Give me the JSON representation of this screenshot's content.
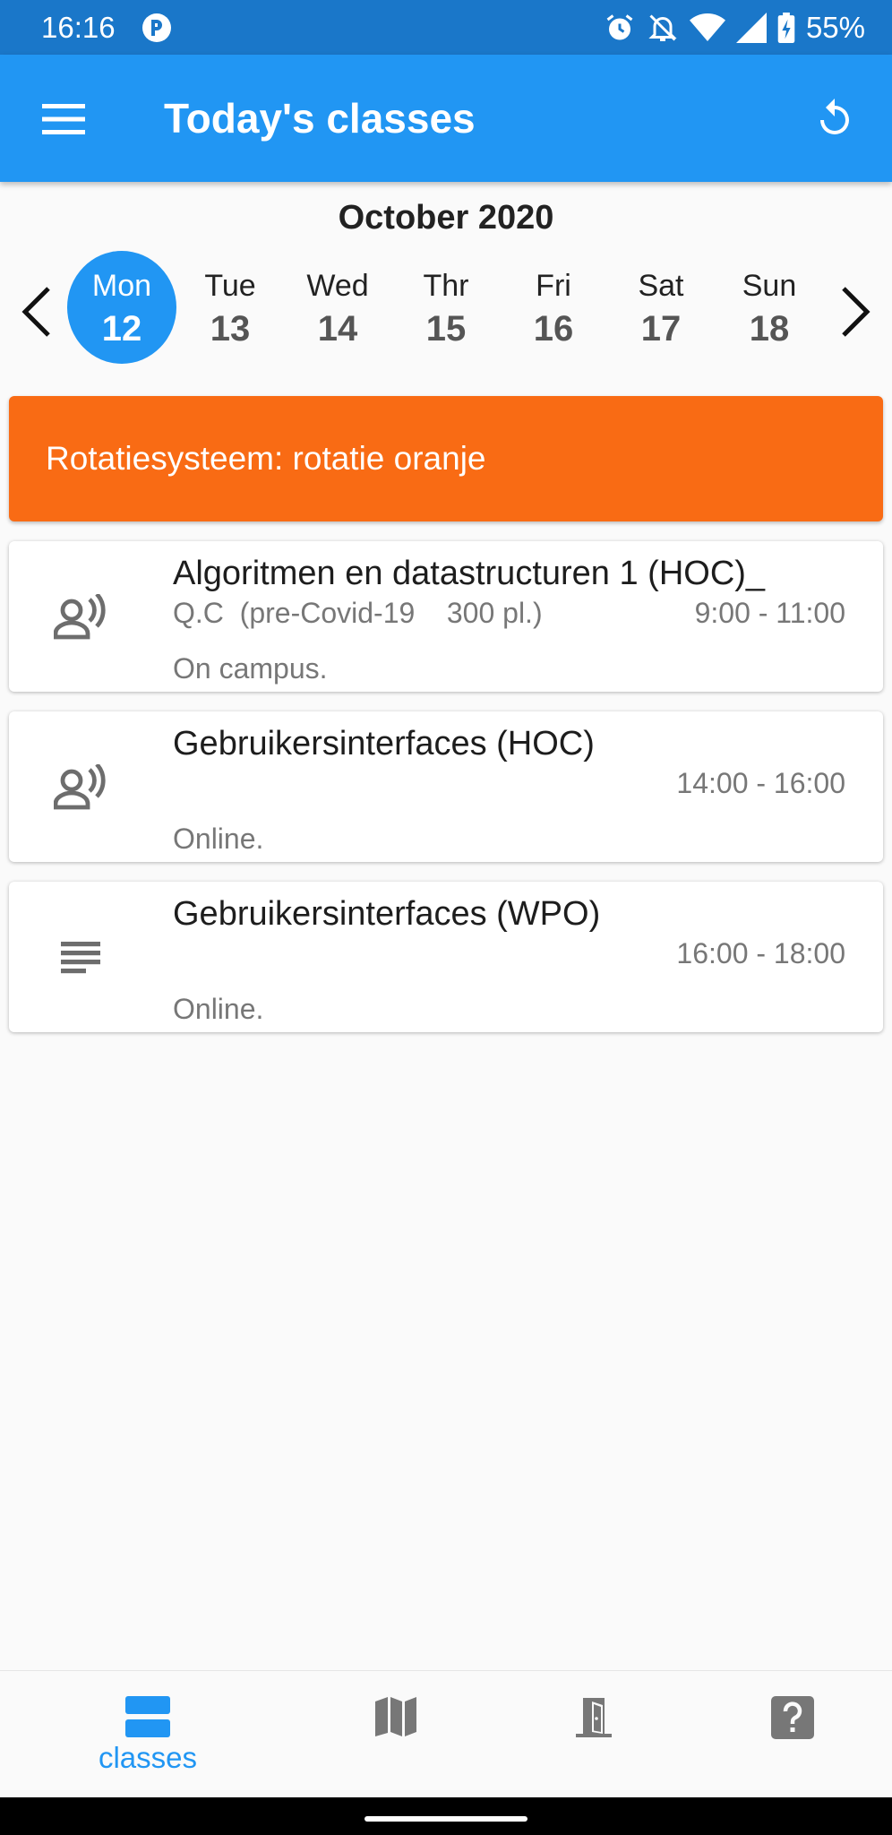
{
  "status_bar": {
    "time": "16:16",
    "battery": "55%",
    "icons": [
      "app-notification-icon",
      "alarm-icon",
      "bell-off-icon",
      "wifi-icon",
      "signal-icon",
      "battery-charging-icon"
    ]
  },
  "app_bar": {
    "title": "Today's classes",
    "menu_icon": "menu-icon",
    "refresh_icon": "refresh-icon"
  },
  "calendar": {
    "month": "October 2020",
    "days": [
      {
        "name": "Mon",
        "num": "12",
        "selected": true
      },
      {
        "name": "Tue",
        "num": "13",
        "selected": false
      },
      {
        "name": "Wed",
        "num": "14",
        "selected": false
      },
      {
        "name": "Thr",
        "num": "15",
        "selected": false
      },
      {
        "name": "Fri",
        "num": "16",
        "selected": false
      },
      {
        "name": "Sat",
        "num": "17",
        "selected": false
      },
      {
        "name": "Sun",
        "num": "18",
        "selected": false
      }
    ]
  },
  "banner": {
    "text": "Rotatiesysteem: rotatie oranje",
    "color": "#f96b14"
  },
  "classes": [
    {
      "icon": "lecture-icon",
      "title": "Algoritmen en datastructuren 1 (HOC)_",
      "location": "Q.C  (pre-Covid-19    300 pl.)",
      "time": "9:00 - 11:00",
      "mode": "On campus."
    },
    {
      "icon": "lecture-icon",
      "title": "Gebruikersinterfaces (HOC)",
      "location": "",
      "time": "14:00 - 16:00",
      "mode": "Online."
    },
    {
      "icon": "notes-icon",
      "title": "Gebruikersinterfaces (WPO)",
      "location": "",
      "time": "16:00 - 18:00",
      "mode": "Online."
    }
  ],
  "bottom_nav": {
    "items": [
      {
        "icon": "classes-icon",
        "label": "classes",
        "active": true
      },
      {
        "icon": "map-icon",
        "label": "",
        "active": false
      },
      {
        "icon": "room-door-icon",
        "label": "",
        "active": false
      },
      {
        "icon": "help-icon",
        "label": "",
        "active": false
      }
    ]
  },
  "colors": {
    "primary": "#2196f3",
    "status_bar": "#1a77c9",
    "banner": "#f96b14",
    "background": "#fafafa"
  }
}
